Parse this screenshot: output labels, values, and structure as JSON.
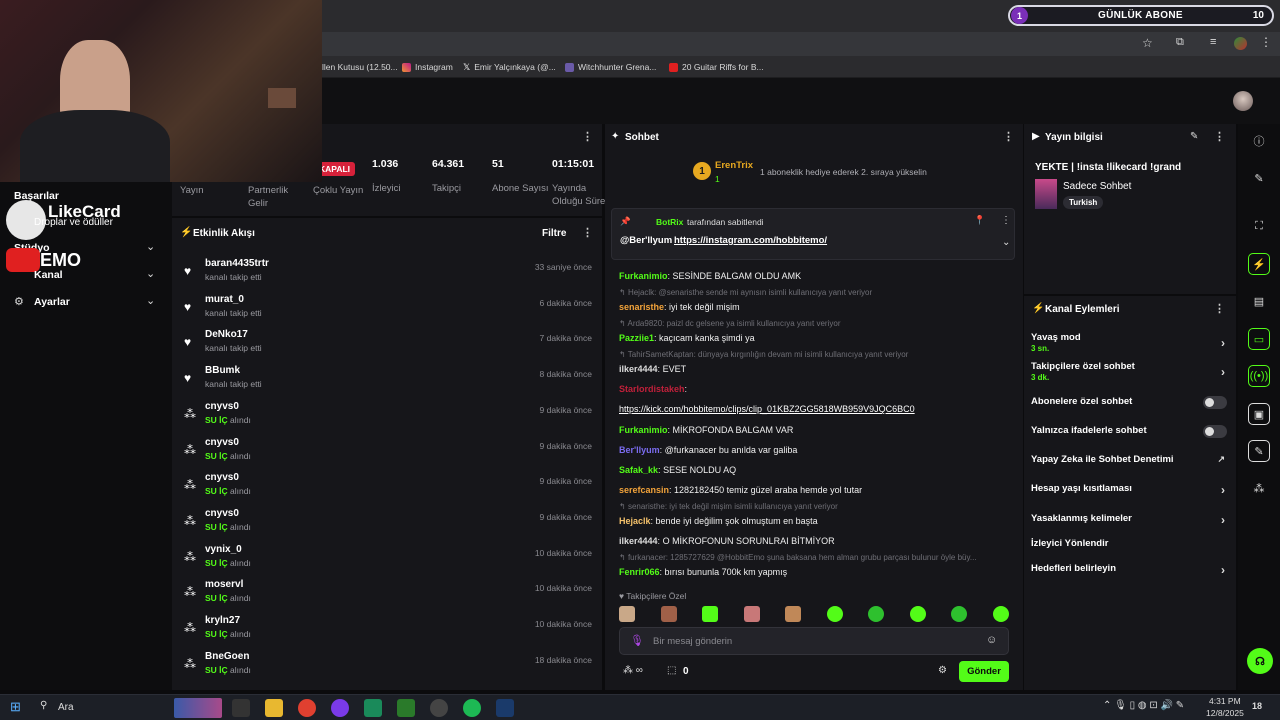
{
  "browser": {
    "bookmarks": [
      "llen Kutusu (12.50...",
      "Instagram",
      "Emir Yalçınkaya (@...",
      "Witchhunter Grena...",
      "20 Guitar Riffs for B..."
    ]
  },
  "overlay": {
    "sub_goal_count": "1",
    "sub_goal_label": "GÜNLÜK ABONE",
    "sub_goal_target": "10",
    "likecard": "LikeCard",
    "likecard_sub": "Droplar ve ödüller",
    "yt_name": "EMO"
  },
  "leftnav": {
    "items": [
      "Başarılar",
      "Stüdyo",
      "Kanal",
      "Ayarlar"
    ]
  },
  "stats": {
    "status": "KAPALI",
    "items": [
      {
        "value": "",
        "label": "Yayın"
      },
      {
        "value": "",
        "label": "Partnerlik Gelir"
      },
      {
        "value": "",
        "label": "Çoklu Yayın"
      },
      {
        "value": "1.036",
        "label": "İzleyici"
      },
      {
        "value": "64.361",
        "label": "Takipçi"
      },
      {
        "value": "51",
        "label": "Abone Sayısı"
      },
      {
        "value": "01:15:01",
        "label": "Yayında Olduğu Süre"
      }
    ]
  },
  "activity": {
    "title": "Etkinlik Akışı",
    "filter": "Filtre",
    "items": [
      {
        "name": "baran4435trtr",
        "desc": "kanalı takip etti",
        "time": "33 saniye önce",
        "kind": "follow"
      },
      {
        "name": "murat_0",
        "desc": "kanalı takip etti",
        "time": "6 dakika önce",
        "kind": "follow"
      },
      {
        "name": "DeNko17",
        "desc": "kanalı takip etti",
        "time": "7 dakika önce",
        "kind": "follow"
      },
      {
        "name": "BBumk",
        "desc": "kanalı takip etti",
        "time": "8 dakika önce",
        "kind": "follow"
      },
      {
        "name": "cnyvs0",
        "reward": "SU İÇ",
        "desc": "alındı",
        "time": "9 dakika önce",
        "kind": "reward"
      },
      {
        "name": "cnyvs0",
        "reward": "SU İÇ",
        "desc": "alındı",
        "time": "9 dakika önce",
        "kind": "reward"
      },
      {
        "name": "cnyvs0",
        "reward": "SU İÇ",
        "desc": "alındı",
        "time": "9 dakika önce",
        "kind": "reward"
      },
      {
        "name": "cnyvs0",
        "reward": "SU İÇ",
        "desc": "alındı",
        "time": "9 dakika önce",
        "kind": "reward"
      },
      {
        "name": "vynix_0",
        "reward": "SU İÇ",
        "desc": "alındı",
        "time": "10 dakika önce",
        "kind": "reward"
      },
      {
        "name": "moservl",
        "reward": "SU İÇ",
        "desc": "alındı",
        "time": "10 dakika önce",
        "kind": "reward"
      },
      {
        "name": "kryln27",
        "reward": "SU İÇ",
        "desc": "alındı",
        "time": "10 dakika önce",
        "kind": "reward"
      },
      {
        "name": "BneGoen",
        "reward": "SU İÇ",
        "desc": "alındı",
        "time": "18 dakika önce",
        "kind": "reward"
      }
    ]
  },
  "chat": {
    "title": "Sohbet",
    "gift_user": "ErenTrix",
    "gift_count": "1",
    "gift_text": "1 aboneklik hediye ederek 2. sıraya yükselin",
    "pinned_by": "BotRix",
    "pinned_label": "tarafından sabitlendi",
    "pinned_user": "@Ber'llyum",
    "pinned_link": "https://instagram.com/hobbitemo/",
    "messages": [
      {
        "type": "msg",
        "user": "Furkanimio",
        "color": "#53fc18",
        "text": "SESİNDE BALGAM OLDU AMK"
      },
      {
        "type": "reply",
        "text": "Hejaclk: @senaristhe sende mi aynısın isimli kullanıcıya yanıt veriyor"
      },
      {
        "type": "msg",
        "user": "senaristhe",
        "color": "#f2a33a",
        "text": "iyi tek değil mişim"
      },
      {
        "type": "reply",
        "text": "Arda9820: paizl dc gelsene ya isimli kullanıcıya yanıt veriyor"
      },
      {
        "type": "msg",
        "user": "Pazziie1",
        "color": "#53fc18",
        "text": "kaçıcam kanka şimdi ya"
      },
      {
        "type": "reply",
        "text": "TahirSametKaptan: dünyaya kırgınlığın devam mi isimli kullanıcıya yanıt veriyor"
      },
      {
        "type": "msg",
        "user": "ilker4444",
        "color": "#dcdcdc",
        "text": "EVET"
      },
      {
        "type": "msg",
        "user": "Starlordistakeh",
        "color": "#c0203a",
        "text": ""
      },
      {
        "type": "link",
        "text": "https://kick.com/hobbitemo/clips/clip_01KBZ2GG5818WB959V9JQC6BC0"
      },
      {
        "type": "msg",
        "user": "Furkanimio",
        "color": "#53fc18",
        "text": "MİKROFONDA BALGAM VAR"
      },
      {
        "type": "msg",
        "user": "Ber'llyum",
        "color": "#7b6cf0",
        "text": "@furkanacer bu anılda var galiba"
      },
      {
        "type": "msg",
        "user": "Safak_kk",
        "color": "#53fc18",
        "text": "SESE NOLDU AQ"
      },
      {
        "type": "msg",
        "user": "serefcansin",
        "color": "#f2a33a",
        "text": "1282182450 temiz güzel araba hemde yol tutar"
      },
      {
        "type": "reply",
        "text": "senaristhe: iyi tek değil mişim isimli kullanıcıya yanıt veriyor"
      },
      {
        "type": "msg",
        "user": "Hejaclk",
        "color": "#f5c26b",
        "text": "bende iyi değilim şok olmuştum en başta"
      },
      {
        "type": "msg",
        "user": "ilker4444",
        "color": "#dcdcdc",
        "text": "O MİKROFONUN SORUNLRAI BİTMİYOR"
      },
      {
        "type": "reply",
        "text": "furkanacer: 1285727629 @HobbitEmo şuna baksana hem alman grubu parçası bulunur öyle büy..."
      },
      {
        "type": "msg",
        "user": "Fenrir066",
        "color": "#53fc18",
        "text": "bırısı bununla 700k km yapmış"
      }
    ],
    "followers_only": "Takipçilere Özel",
    "input_placeholder": "Bir mesaj gönderin",
    "points": "0",
    "send": "Gönder"
  },
  "info": {
    "title": "Yayın bilgisi",
    "stream_title": "YEKTE | !insta !likecard !grand",
    "category": "Sadece Sohbet",
    "language": "Turkish"
  },
  "actions": {
    "title": "Kanal Eylemleri",
    "items": [
      {
        "label": "Yavaş mod",
        "sub": "3 sn.",
        "control": "chevron"
      },
      {
        "label": "Takipçilere özel sohbet",
        "sub": "3 dk.",
        "control": "chevron"
      },
      {
        "label": "Abonelere özel sohbet",
        "sub": "",
        "control": "toggle"
      },
      {
        "label": "Yalnızca ifadelerle sohbet",
        "sub": "",
        "control": "toggle"
      },
      {
        "label": "Yapay Zeka ile Sohbet Denetimi",
        "sub": "",
        "control": "external"
      },
      {
        "label": "Hesap yaşı kısıtlaması",
        "sub": "",
        "control": "chevron"
      },
      {
        "label": "Yasaklanmış kelimeler",
        "sub": "",
        "control": "chevron"
      },
      {
        "label": "İzleyici Yönlendir",
        "sub": "",
        "control": "none"
      },
      {
        "label": "Hedefleri belirleyin",
        "sub": "",
        "control": "chevron"
      }
    ]
  },
  "taskbar": {
    "search": "Ara",
    "time": "4:31 PM",
    "date": "12/8/2025",
    "notif": "18"
  },
  "colors": {
    "accent": "#53fc18",
    "panel": "#16161a",
    "danger": "#d6213a"
  }
}
